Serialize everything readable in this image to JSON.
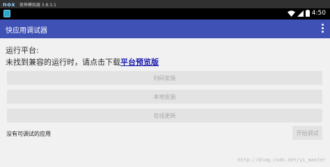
{
  "emulator": {
    "logo": "nox",
    "title": "夜神模拟器 3.8.3.1"
  },
  "status_bar": {
    "time": "4:50"
  },
  "app_bar": {
    "title": "快应用调试器"
  },
  "platform": {
    "label": "运行平台:",
    "message": "未找到兼容的运行时，请点击下载",
    "link": "平台预览版"
  },
  "buttons": {
    "scan": "扫码安装",
    "local": "本地安装",
    "online": "在线更新"
  },
  "bottom": {
    "no_apps": "没有可调试的应用",
    "start": "开始调试"
  },
  "watermark": "http://blog.csdn.net/yi_master"
}
